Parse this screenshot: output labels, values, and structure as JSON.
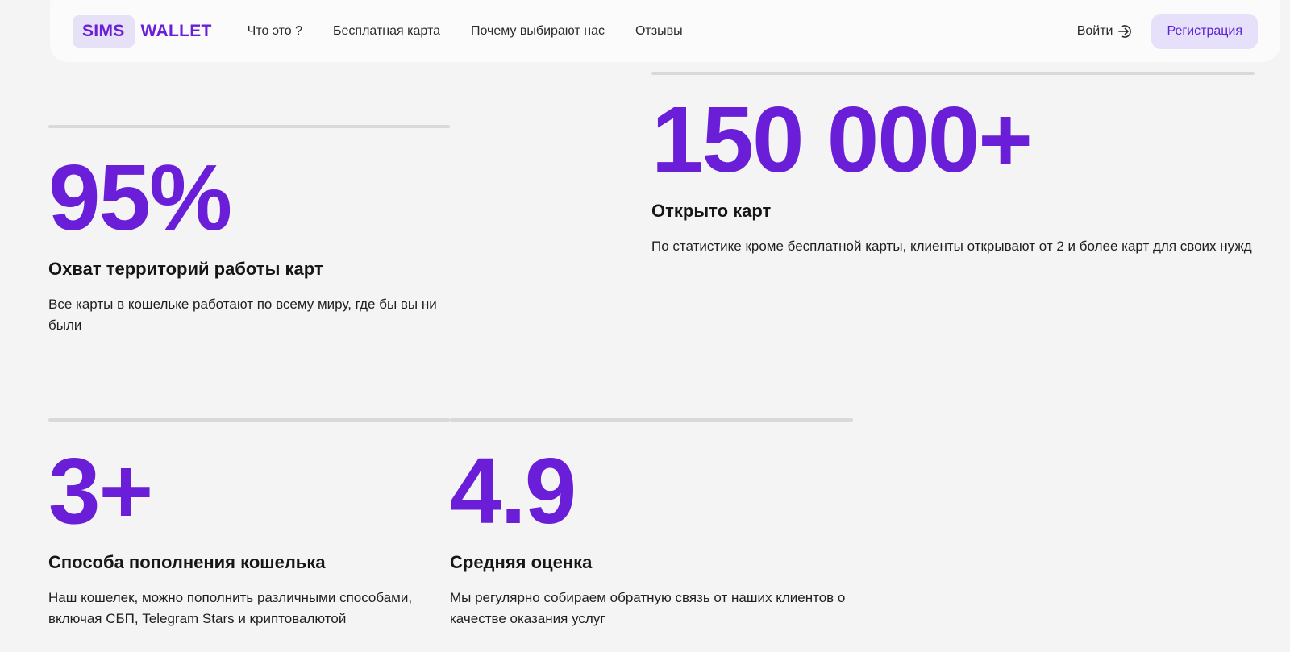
{
  "header": {
    "logo_box": "SIMS",
    "logo_text": "WALLET",
    "nav": [
      "Что это ?",
      "Бесплатная карта",
      "Почему выбирают нас",
      "Отзывы"
    ],
    "login_label": "Войти",
    "register_label": "Регистрация"
  },
  "stats": [
    {
      "value": "95%",
      "title": "Охват территорий работы карт",
      "desc": "Все карты в кошельке работают по всему миру, где бы вы ни были"
    },
    {
      "value": "150 000+",
      "title": "Открыто карт",
      "desc": "По статистике кроме бесплатной карты, клиенты открывают от 2 и более карт для своих нужд"
    },
    {
      "value": "3+",
      "title": "Способа пополнения кошелька",
      "desc": "Наш кошелек, можно пополнить различными способами, включая СБП, Telegram Stars и криптовалютой"
    },
    {
      "value": "4.9",
      "title": "Средняя оценка",
      "desc": "Мы регулярно собираем обратную связь от наших клиентов о качестве оказания услуг"
    }
  ],
  "colors": {
    "accent": "#6a1ed8",
    "background": "#f4f4f5",
    "divider": "#d9d9dc"
  }
}
